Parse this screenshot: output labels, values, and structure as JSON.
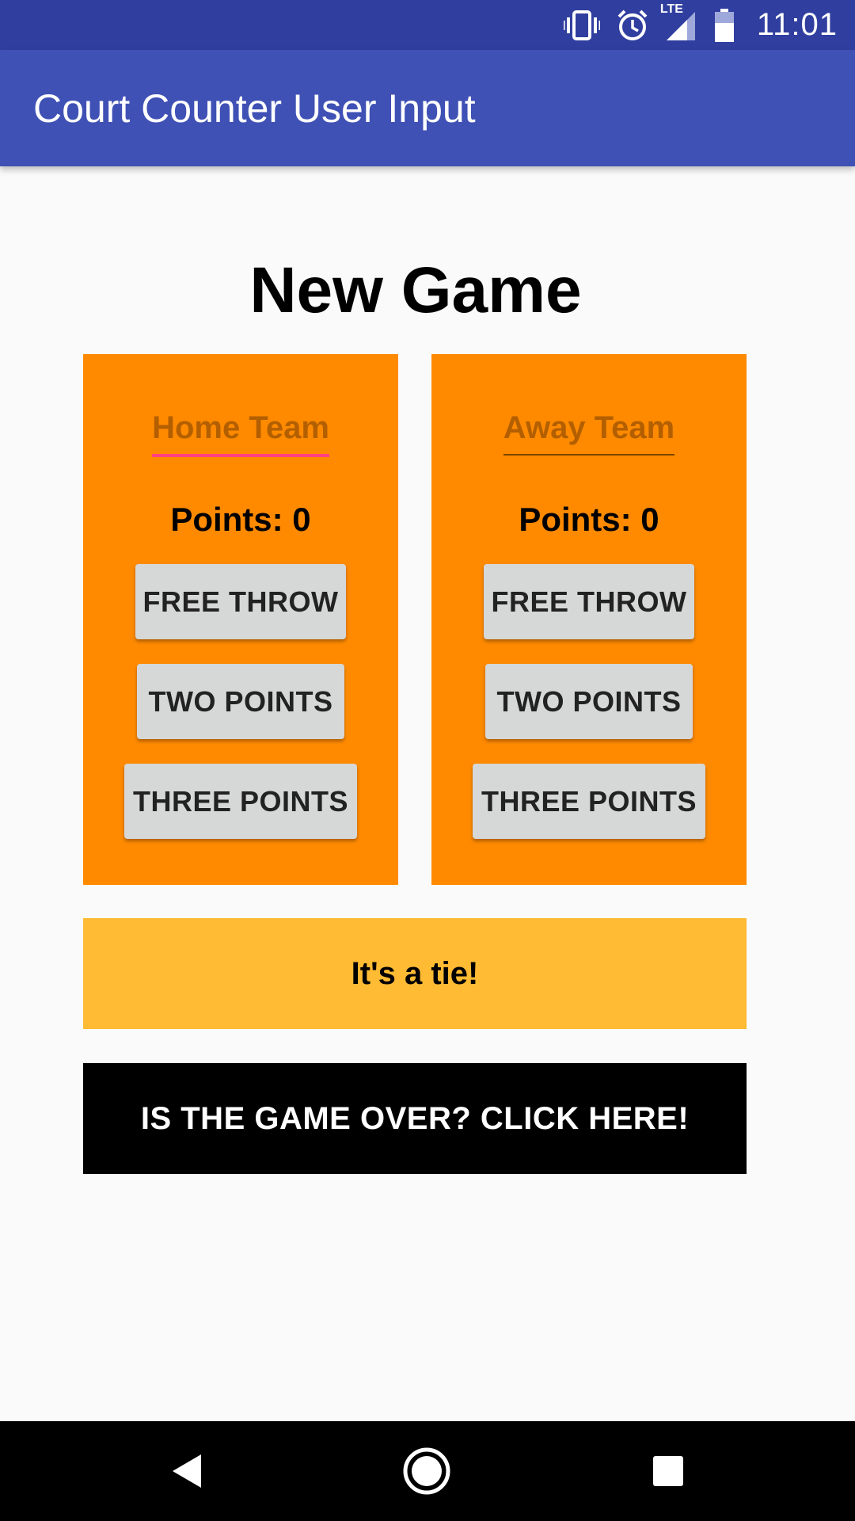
{
  "status_bar": {
    "time": "11:01",
    "network": "LTE",
    "icons": [
      "vibrate-icon",
      "alarm-icon",
      "signal-icon",
      "battery-icon"
    ]
  },
  "app_bar": {
    "title": "Court Counter User Input"
  },
  "main": {
    "title": "New Game",
    "home": {
      "team_name": "Home Team",
      "points_label": "Points: 0",
      "free_throw": "FREE THROW",
      "two_points": "TWO POINTS",
      "three_points": "THREE POINTS"
    },
    "away": {
      "team_name": "Away Team",
      "points_label": "Points: 0",
      "free_throw": "FREE THROW",
      "two_points": "TWO POINTS",
      "three_points": "THREE POINTS"
    },
    "result": "It's a tie!",
    "game_over_button": "IS THE GAME OVER? CLICK HERE!"
  },
  "nav_bar": {
    "icons": [
      "back-icon",
      "home-icon",
      "recents-icon"
    ]
  },
  "colors": {
    "status_bar": "#303f9f",
    "app_bar": "#3f51b5",
    "team_panel": "#ff8a00",
    "result_bar": "#ffbb33",
    "focus_underline": "#ff4081"
  }
}
